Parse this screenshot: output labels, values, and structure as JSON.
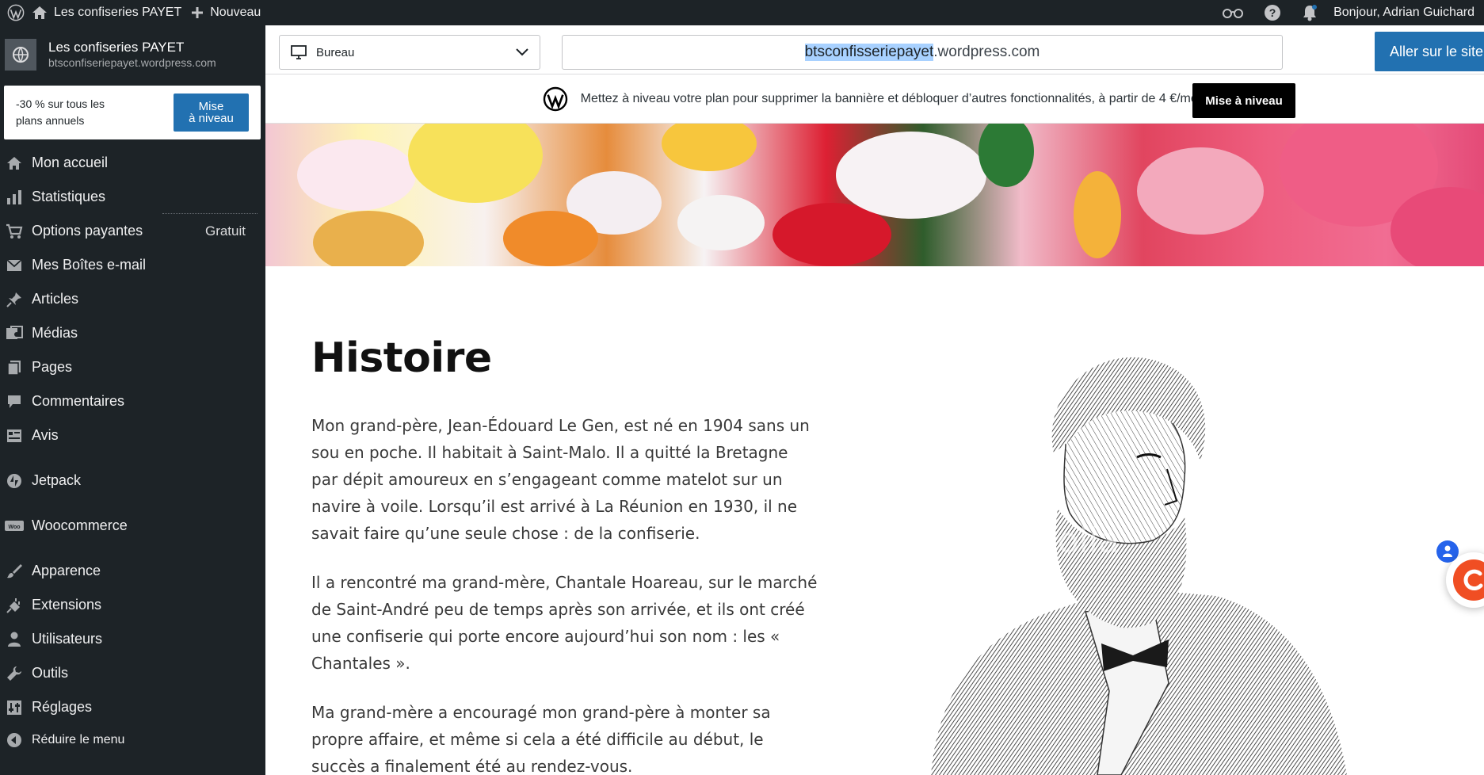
{
  "adminbar": {
    "site_title": "Les confiseries PAYET",
    "new_label": "Nouveau",
    "greeting": "Bonjour, Adrian Guichard"
  },
  "sidebar": {
    "site_name": "Les confiseries PAYET",
    "site_url": "btsconfiseriepayet.wordpress.com",
    "promo_text": "-30 % sur tous les plans annuels",
    "promo_button_line1": "Mise",
    "promo_button_line2": "à niveau",
    "items": [
      {
        "label": "Mon accueil",
        "icon": "home-icon"
      },
      {
        "label": "Statistiques",
        "icon": "stats-icon"
      },
      {
        "label": "Options payantes",
        "icon": "cart-icon",
        "badge": "Gratuit"
      },
      {
        "label": "Mes Boîtes e-mail",
        "icon": "mail-icon"
      },
      {
        "label": "Articles",
        "icon": "pin-icon"
      },
      {
        "label": "Médias",
        "icon": "media-icon"
      },
      {
        "label": "Pages",
        "icon": "pages-icon"
      },
      {
        "label": "Commentaires",
        "icon": "comment-icon"
      },
      {
        "label": "Avis",
        "icon": "feedback-icon"
      },
      {
        "label": "Jetpack",
        "icon": "jetpack-icon"
      },
      {
        "label": "Woocommerce",
        "icon": "woo-icon"
      },
      {
        "label": "Apparence",
        "icon": "brush-icon"
      },
      {
        "label": "Extensions",
        "icon": "plugin-icon"
      },
      {
        "label": "Utilisateurs",
        "icon": "user-icon"
      },
      {
        "label": "Outils",
        "icon": "wrench-icon"
      },
      {
        "label": "Réglages",
        "icon": "settings-icon"
      }
    ],
    "collapse_label": "Réduire le menu"
  },
  "toolbar": {
    "device": "Bureau",
    "url_highlight": "btsconfisseriepayet",
    "url_rest": ".wordpress.com",
    "go_label": "Aller sur le site"
  },
  "banner": {
    "text": "Mettez à niveau votre plan pour supprimer la bannière et débloquer d’autres fonctionnalités, à partir de 4 €/mois",
    "button": "Mise à niveau"
  },
  "page": {
    "title": "Histoire",
    "paragraphs": [
      "Mon grand-père, Jean-Édouard Le Gen, est né en 1904 sans un sou en poche. Il habitait à Saint-Malo. Il a quitté la Bretagne par dépit amoureux en s’engageant comme matelot sur un navire à voile. Lorsqu’il est arrivé à La Réunion en 1930, il ne savait faire qu’une seule chose : de la confiserie.",
      "Il a rencontré ma grand-mère, Chantale Hoareau, sur le marché de Saint-André peu de temps après son arrivée, et ils ont créé une confiserie qui porte encore aujourd’hui son nom : les « Chantales ».",
      "Ma grand-mère a encouragé mon grand-père à monter sa propre affaire, et même si cela a été difficile au début, le succès a finalement été au rendez-vous."
    ],
    "watermark": "fotolia"
  },
  "colors": {
    "admin_bg": "#1d2327",
    "accent": "#2271b1"
  }
}
